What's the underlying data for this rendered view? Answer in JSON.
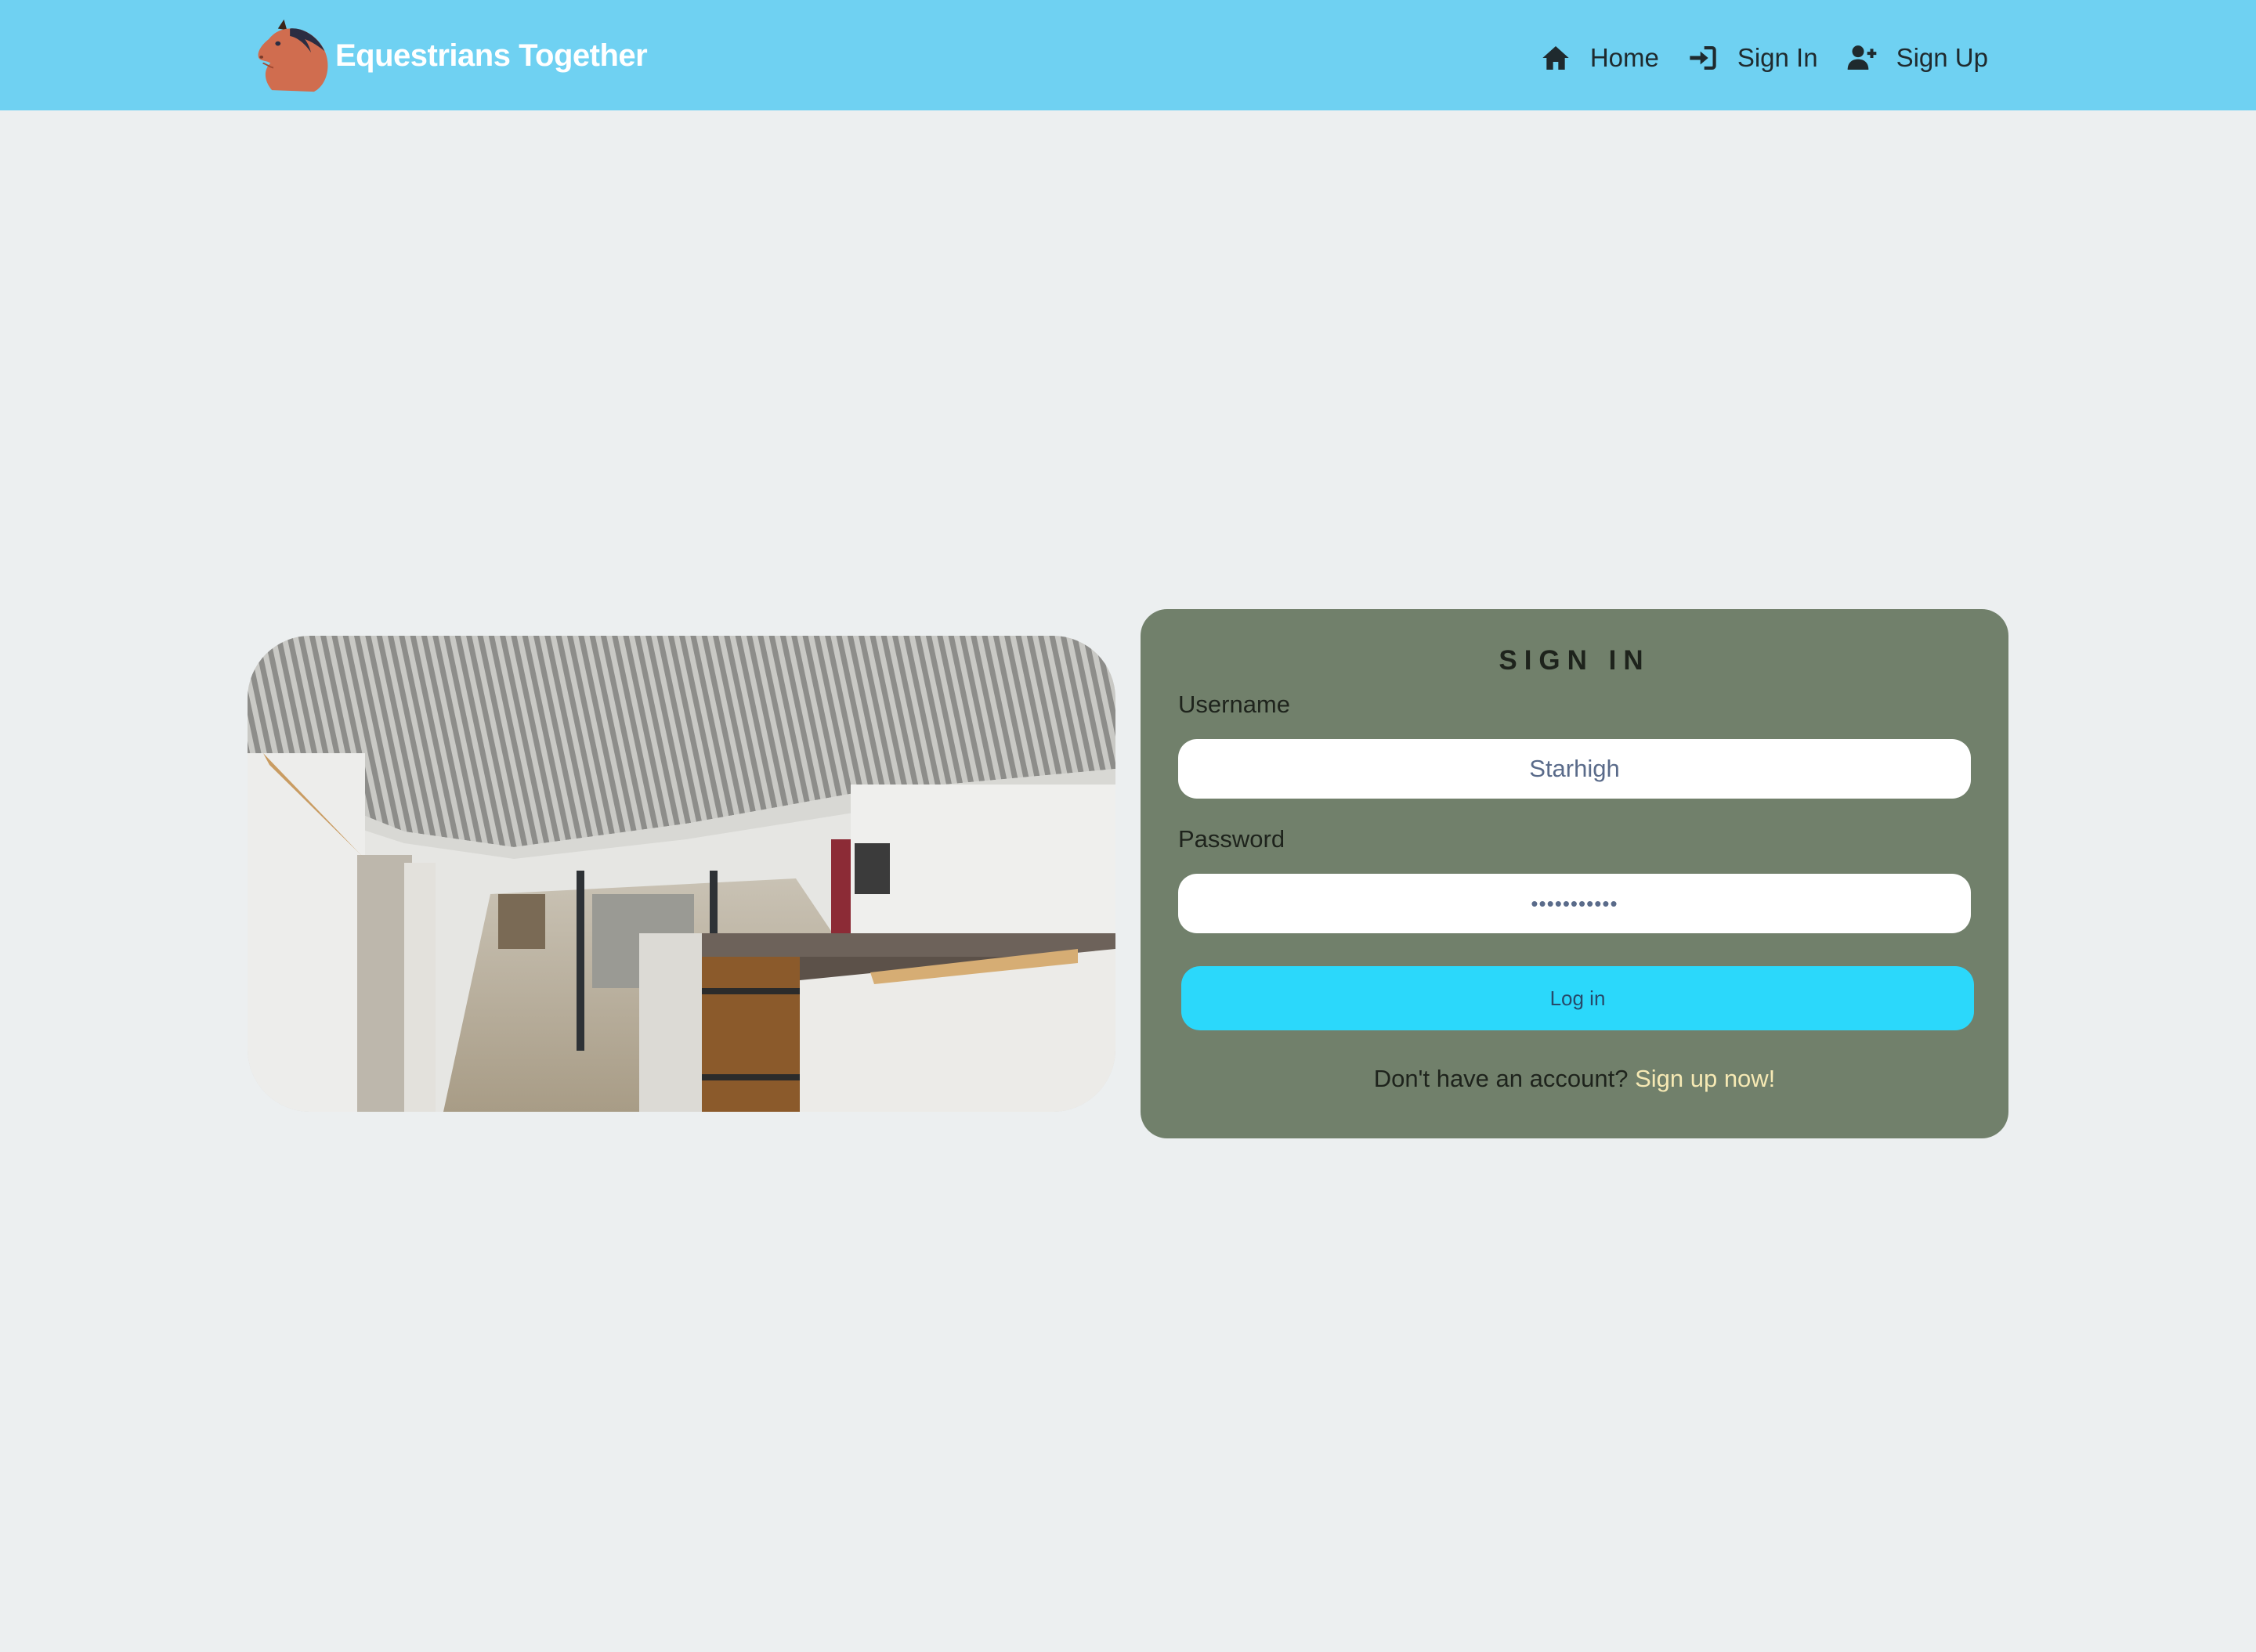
{
  "navbar": {
    "brand": "Equestrians Together",
    "logo_icon": "horse-head-icon",
    "items": [
      {
        "label": "Home",
        "icon": "home-icon"
      },
      {
        "label": "Sign In",
        "icon": "sign-in-icon"
      },
      {
        "label": "Sign Up",
        "icon": "user-plus-icon"
      }
    ]
  },
  "hero_image": {
    "description_icon": "stable-photo"
  },
  "signin": {
    "title": "SIGN IN",
    "username_label": "Username",
    "username_value": "Starhigh",
    "password_label": "Password",
    "password_value": "starhigh123",
    "submit_label": "Log in",
    "no_account_text": "Don't have an account? ",
    "signup_link": "Sign up now!"
  },
  "colors": {
    "navbar": "#6fd1f2",
    "background": "#eceff0",
    "card": "#71806b",
    "button": "#2bd8fb",
    "link": "#f6e9b4"
  }
}
